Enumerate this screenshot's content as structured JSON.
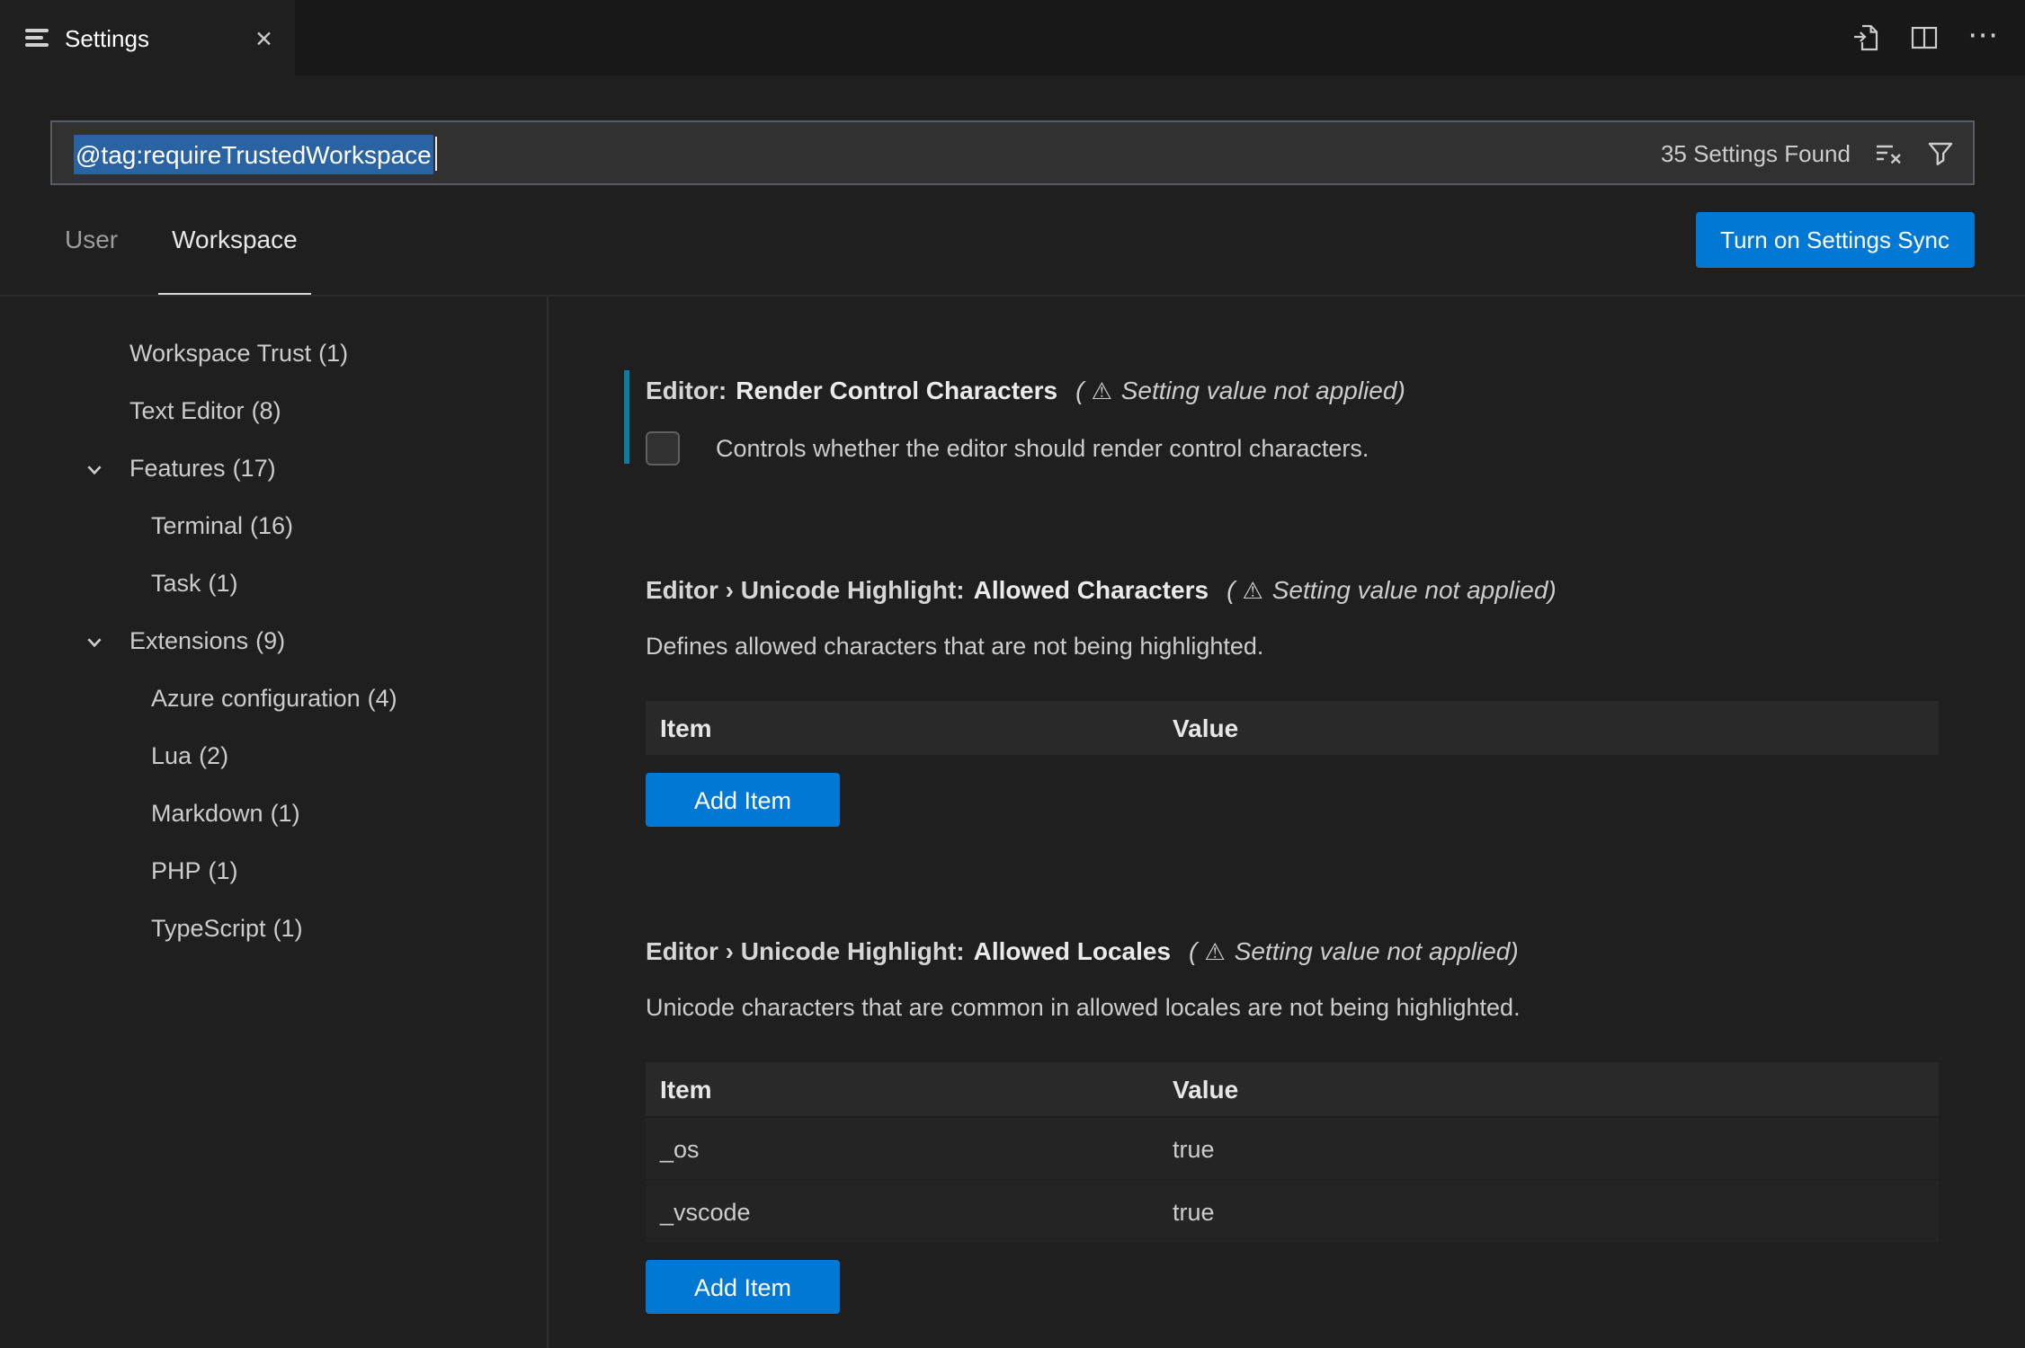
{
  "colors": {
    "background": "#1f1f1f",
    "accent_blue": "#0078d4",
    "modified_indicator": "#0c7d9d",
    "selection_blue": "#2a63a4"
  },
  "tab": {
    "title": "Settings"
  },
  "icons": {
    "close": "✕",
    "more_actions": "⋯",
    "warning": "⚠"
  },
  "search": {
    "query": "@tag:requireTrustedWorkspace",
    "results": "35 Settings Found"
  },
  "scope_tabs": [
    {
      "label": "User"
    },
    {
      "label": "Workspace"
    }
  ],
  "sync_button_label": "Turn on Settings Sync",
  "toc": [
    {
      "label": "Workspace Trust",
      "count": "(1)"
    },
    {
      "label": "Text Editor",
      "count": "(8)"
    },
    {
      "label": "Features",
      "count": "(17)"
    },
    {
      "label": "Terminal",
      "count": "(16)"
    },
    {
      "label": "Task",
      "count": "(1)"
    },
    {
      "label": "Extensions",
      "count": "(9)"
    },
    {
      "label": "Azure configuration",
      "count": "(4)"
    },
    {
      "label": "Lua",
      "count": "(2)"
    },
    {
      "label": "Markdown",
      "count": "(1)"
    },
    {
      "label": "PHP",
      "count": "(1)"
    },
    {
      "label": "TypeScript",
      "count": "(1)"
    }
  ],
  "warning": {
    "open": "(",
    "text": "Setting value not applied",
    "close": ")"
  },
  "settings": [
    {
      "category": "Editor:",
      "label": "Render Control Characters",
      "description": "Controls whether the editor should render control characters.",
      "checked": false
    },
    {
      "category": "Editor › Unicode Highlight:",
      "label": "Allowed Characters",
      "description": "Defines allowed characters that are not being highlighted.",
      "columns": [
        "Item",
        "Value"
      ],
      "add_button": "Add Item"
    },
    {
      "category": "Editor › Unicode Highlight:",
      "label": "Allowed Locales",
      "description": "Unicode characters that are common in allowed locales are not being highlighted.",
      "columns": [
        "Item",
        "Value"
      ],
      "rows": [
        {
          "item": "_os",
          "value": "true"
        },
        {
          "item": "_vscode",
          "value": "true"
        }
      ],
      "add_button": "Add Item"
    }
  ]
}
